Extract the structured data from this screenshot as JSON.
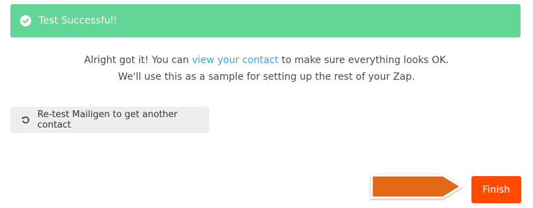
{
  "banner": {
    "message": "Test Successful!",
    "icon": "check-circle-icon",
    "color": "#63d596"
  },
  "message": {
    "line1_before": "Alright got it! You can ",
    "line1_link": "view your contact",
    "line1_after": " to make sure everything looks OK.",
    "line2": "We'll use this as a sample for setting up the rest of your Zap."
  },
  "retest_button": {
    "label": "Re-test Mailigen to get another contact",
    "icon": "undo-icon"
  },
  "finish_button": {
    "label": "Finish",
    "color": "#ff4a00"
  },
  "annotation": {
    "icon": "arrow-right-icon",
    "color": "#e26a12"
  }
}
